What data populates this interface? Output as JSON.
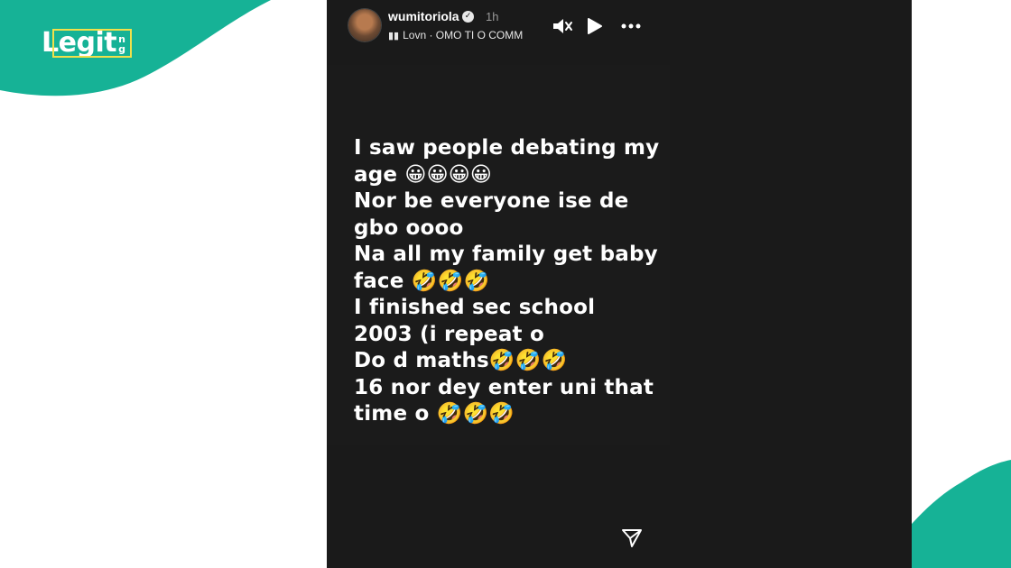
{
  "brand": {
    "logo_text": "Legit",
    "logo_suffix_top": "n",
    "logo_suffix_bottom": "g",
    "brand_green": "#16b296",
    "logo_frame_color": "#f1e04a"
  },
  "story": {
    "username": "wumitoriola",
    "time": "1h",
    "music": "Lovn · OMO TI O COMM",
    "icons": {
      "avatar": "profile-avatar",
      "verified": "verified-badge-icon",
      "music": "music-bars-icon",
      "mute": "speaker-muted-icon",
      "play": "play-icon",
      "more": "more-dots-icon",
      "send": "send-icon"
    },
    "caption_lines": [
      "I saw people debating my",
      "age 😀😀😀😀",
      "Nor be everyone ise de",
      "gbo oooo",
      "Na all my family get baby",
      "face 🤣🤣🤣",
      "I finished sec school",
      "2003 (i repeat o",
      "Do d maths🤣🤣🤣",
      "16 nor dey enter uni that",
      "time o 🤣🤣🤣"
    ]
  }
}
